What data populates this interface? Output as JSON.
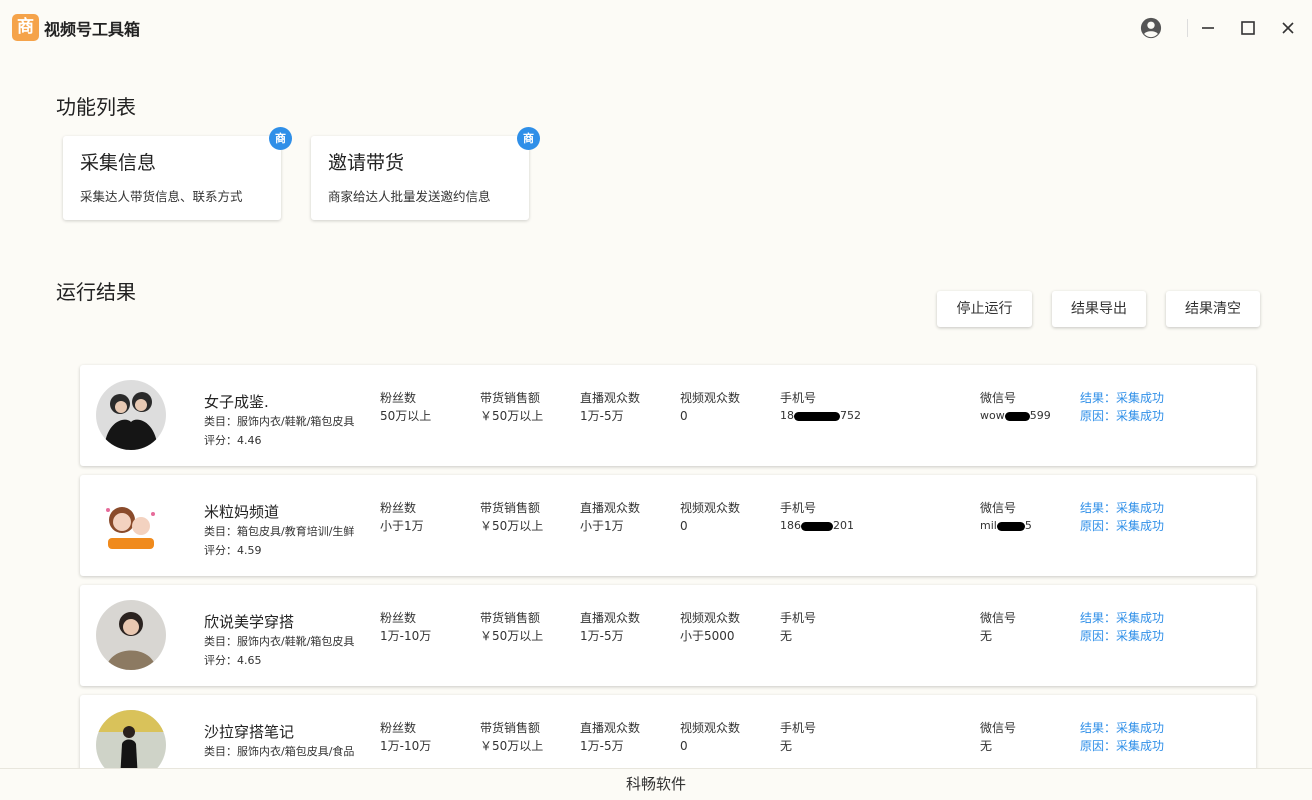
{
  "app": {
    "logo_char": "商",
    "title": "视频号工具箱"
  },
  "sections": {
    "features_title": "功能列表",
    "results_title": "运行结果"
  },
  "features": [
    {
      "title": "采集信息",
      "desc": "采集达人带货信息、联系方式",
      "badge": "商"
    },
    {
      "title": "邀请带货",
      "desc": "商家给达人批量发送邀约信息",
      "badge": "商"
    }
  ],
  "actions": {
    "stop": "停止运行",
    "export": "结果导出",
    "clear": "结果清空"
  },
  "labels": {
    "fans": "粉丝数",
    "sales": "带货销售额",
    "live": "直播观众数",
    "video": "视频观众数",
    "phone": "手机号",
    "wechat": "微信号"
  },
  "results": [
    {
      "name": "女子成鉴.",
      "category": "类目：服饰内衣/鞋靴/箱包皮具",
      "rating": "评分：4.46",
      "fans": "50万以上",
      "sales": "￥50万以上",
      "live": "1万-5万",
      "video": "0",
      "phone_pre": "18",
      "phone_post": "752",
      "wechat_pre": "wow",
      "wechat_post": "599",
      "result": "结果：采集成功",
      "reason": "原因：采集成功"
    },
    {
      "name": "米粒妈频道",
      "category": "类目：箱包皮具/教育培训/生鲜",
      "rating": "评分：4.59",
      "fans": "小于1万",
      "sales": "￥50万以上",
      "live": "小于1万",
      "video": "0",
      "phone_pre": "186",
      "phone_post": "201",
      "wechat_pre": "mil",
      "wechat_post": "5",
      "result": "结果：采集成功",
      "reason": "原因：采集成功"
    },
    {
      "name": "欣说美学穿搭",
      "category": "类目：服饰内衣/鞋靴/箱包皮具",
      "rating": "评分：4.65",
      "fans": "1万-10万",
      "sales": "￥50万以上",
      "live": "1万-5万",
      "video": "小于5000",
      "phone": "无",
      "wechat": "无",
      "result": "结果：采集成功",
      "reason": "原因：采集成功"
    },
    {
      "name": "沙拉穿搭笔记",
      "category": "类目：服饰内衣/箱包皮具/食品",
      "rating": "",
      "fans": "1万-10万",
      "sales": "￥50万以上",
      "live": "1万-5万",
      "video": "0",
      "phone": "无",
      "wechat": "无",
      "result": "结果：采集成功",
      "reason": "原因：采集成功"
    }
  ],
  "footer": "科畅软件",
  "colors": {
    "accent": "#2f8fe8",
    "logo": "#f5a34a",
    "background": "#fcfbf6"
  }
}
